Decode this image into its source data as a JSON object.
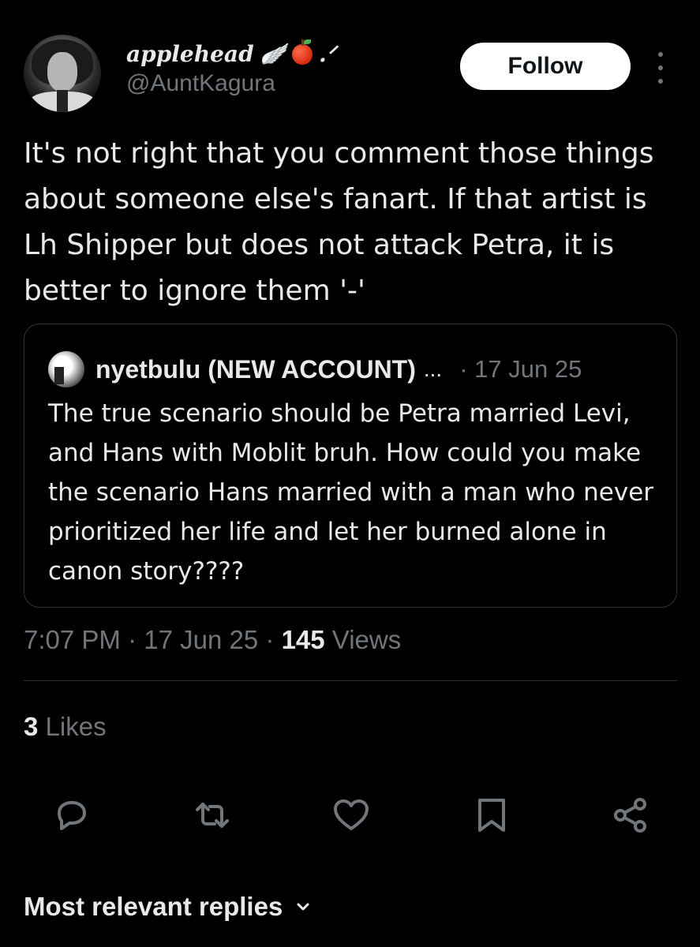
{
  "author": {
    "display_name": "applehead",
    "display_suffix": ".ᐟ",
    "handle": "@AuntKagura",
    "follow_label": "Follow"
  },
  "tweet": {
    "text": "It's not right that you comment those things about someone else's fanart. If that artist is Lh Shipper but does not attack Petra, it is better to ignore them '-'",
    "time": "7:07 PM",
    "date": "17 Jun 25",
    "views_count": "145",
    "views_label": "Views",
    "likes_count": "3",
    "likes_label": "Likes"
  },
  "quote": {
    "name": "nyetbulu (NEW ACCOUNT)",
    "ellipsis": "...",
    "date": "· 17 Jun 25",
    "text": "The true scenario should be Petra married Levi, and Hans with Moblit bruh. How could you make the scenario Hans married with a man who never prioritized her life and let her burned alone in canon story????"
  },
  "separators": {
    "dot": "·"
  },
  "replies": {
    "label": "Most relevant replies"
  },
  "icons": [
    "wing-icon",
    "apple-icon",
    "more-icon",
    "reply-icon",
    "retweet-icon",
    "like-icon",
    "bookmark-icon",
    "share-icon",
    "chevron-down-icon"
  ],
  "colors": {
    "background": "#000000",
    "text": "#e7e9ea",
    "muted": "#71767b",
    "border": "#2f3336",
    "follow_bg": "#ffffff"
  }
}
